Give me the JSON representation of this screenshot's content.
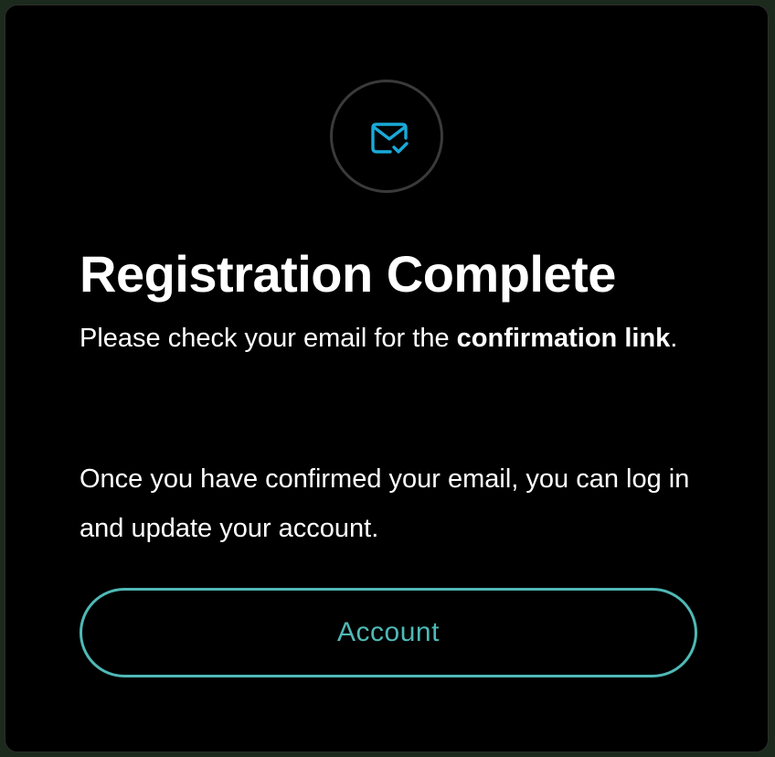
{
  "card": {
    "icon": "mail-check-icon",
    "title": "Registration Complete",
    "message1_prefix": "Please check your email for the ",
    "message1_bold": "confirmation link",
    "message1_suffix": ".",
    "message2": "Once you have confirmed your email, you can log in and update your account.",
    "button_label": "Account"
  },
  "colors": {
    "accent": "#4fb9b6",
    "icon": "#19a9d8",
    "background": "#000000",
    "text": "#ffffff"
  }
}
